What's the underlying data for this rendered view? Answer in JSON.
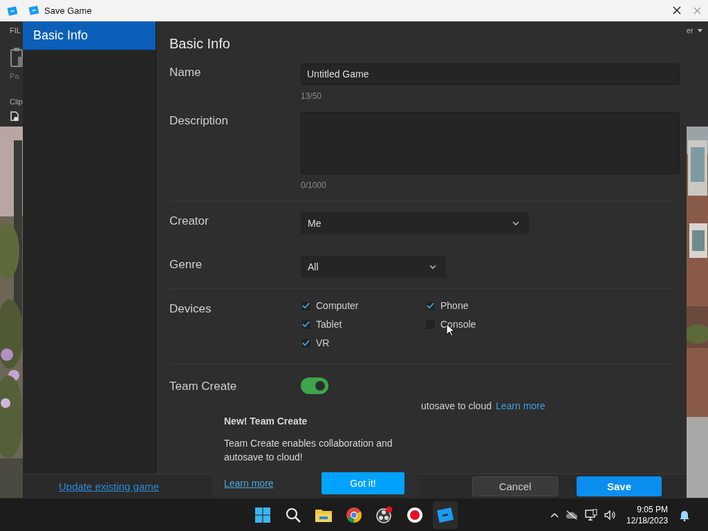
{
  "app": {
    "menu_tab": "FIL",
    "ribbon_labels": [
      "Pa",
      "Clip"
    ],
    "right_menu": "er"
  },
  "dialog": {
    "title": "Save Game",
    "sidebar": {
      "items": [
        {
          "label": "Basic Info",
          "selected": true
        }
      ]
    },
    "heading": "Basic Info",
    "fields": [
      {
        "kind": "text",
        "label": "Name",
        "value": "Untitled Game",
        "counter": "13/50"
      },
      {
        "kind": "textarea",
        "label": "Description",
        "counter": "0/1000"
      },
      {
        "kind": "dropdown",
        "label": "Creator",
        "value": "Me"
      },
      {
        "kind": "dropdown",
        "label": "Genre",
        "value": "All"
      },
      {
        "kind": "checkboxes",
        "label": "Devices",
        "options": [
          {
            "label": "Computer",
            "checked": true
          },
          {
            "label": "Phone",
            "checked": true
          },
          {
            "label": "Tablet",
            "checked": true
          },
          {
            "label": "Console",
            "checked": false
          },
          {
            "label": "VR",
            "checked": true
          }
        ]
      },
      {
        "kind": "toggle",
        "label": "Team Create",
        "on": true,
        "description": "utosave to cloud",
        "link": "Learn more"
      }
    ],
    "footer": {
      "link": "Update existing game",
      "buttons": [
        {
          "label": "Cancel",
          "kind": "secondary"
        },
        {
          "label": "Save",
          "kind": "primary"
        }
      ]
    }
  },
  "popup": {
    "title": "New! Team Create",
    "text": "Team Create enables collaboration and autosave to cloud!",
    "link": "Learn more",
    "button": "Got it!"
  },
  "taskbar": {
    "time": "9:05 PM",
    "date": "12/18/2023"
  }
}
